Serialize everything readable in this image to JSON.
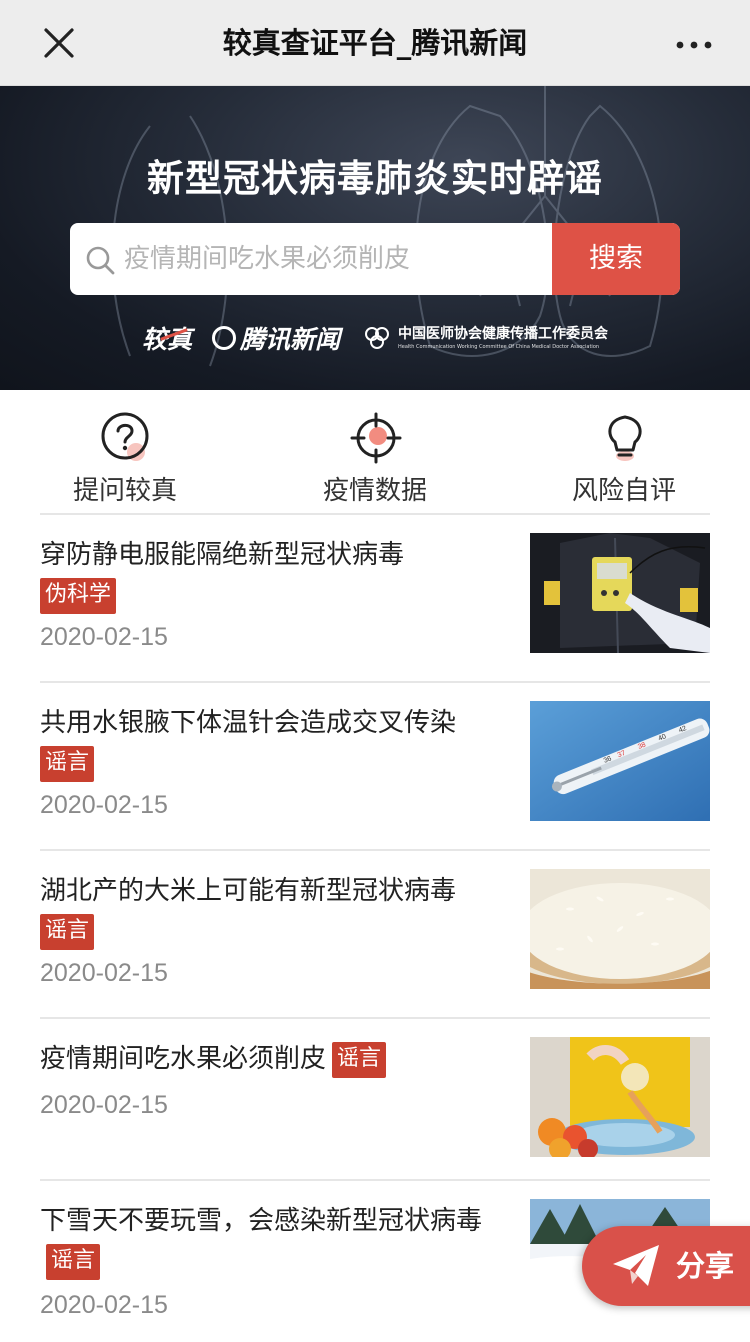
{
  "navbar": {
    "title": "较真查证平台_腾讯新闻",
    "close_icon": "close-icon",
    "more_icon": "more-dots-icon"
  },
  "banner": {
    "title": "新型冠状病毒肺炎实时辟谣",
    "search_placeholder": "疫情期间吃水果必须削皮",
    "search_button": "搜索",
    "logo_jiaozhen": "较真",
    "logo_tencent": "腾讯新闻",
    "logo_assoc_cn": "中国医师协会健康传播工作委员会",
    "logo_assoc_en": "Health Communication Working Committee Of China Medical Doctor Association"
  },
  "actions": [
    {
      "label": "提问较真",
      "icon": "question-icon"
    },
    {
      "label": "疫情数据",
      "icon": "target-icon"
    },
    {
      "label": "风险自评",
      "icon": "lightbulb-icon"
    }
  ],
  "news": [
    {
      "title": "穿防静电服能隔绝新型冠状病毒",
      "tag": "伪科学",
      "date": "2020-02-15",
      "image": "anti-static-suit-photo"
    },
    {
      "title": "共用水银腋下体温针会造成交叉传染",
      "tag": "谣言",
      "date": "2020-02-15",
      "image": "thermometer-photo"
    },
    {
      "title": "湖北产的大米上可能有新型冠状病毒",
      "tag": "谣言",
      "date": "2020-02-15",
      "image": "rice-photo"
    },
    {
      "title": "疫情期间吃水果必须削皮",
      "tag": "谣言",
      "date": "2020-02-15",
      "image": "peeling-apple-photo"
    },
    {
      "title": "下雪天不要玩雪，会感染新型冠状病毒",
      "tag": "谣言",
      "date": "2020-02-15",
      "image": "snow-photo"
    }
  ],
  "share": {
    "label": "分享",
    "icon": "paper-plane-icon"
  },
  "colors": {
    "accent": "#de5246",
    "tag": "#c8402f",
    "banner_dark": "#151a24"
  }
}
